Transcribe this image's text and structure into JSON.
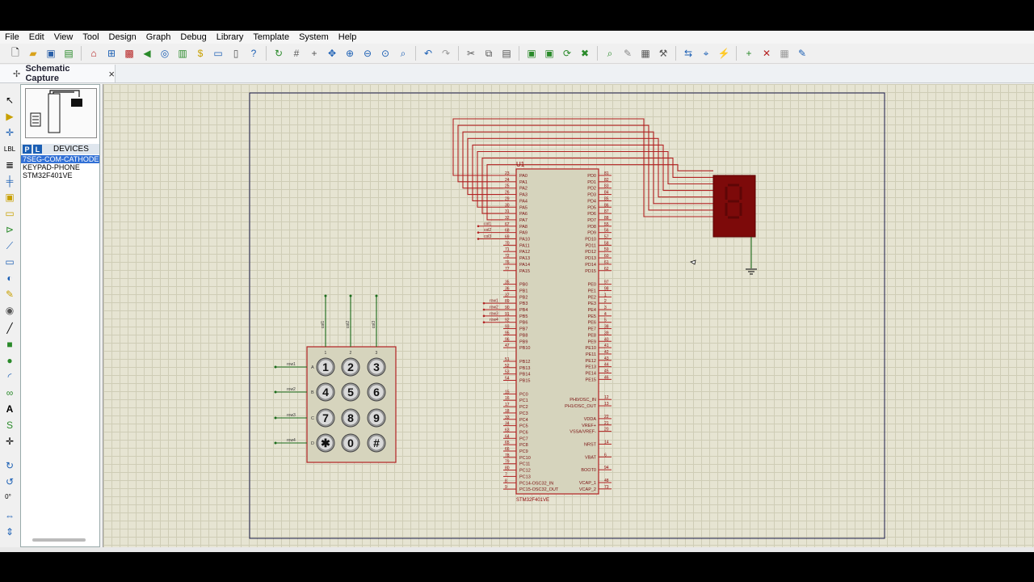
{
  "menu": [
    "File",
    "Edit",
    "View",
    "Tool",
    "Design",
    "Graph",
    "Debug",
    "Library",
    "Template",
    "System",
    "Help"
  ],
  "tab": {
    "label": "Schematic Capture",
    "close": "×"
  },
  "devices": {
    "title": "DEVICES",
    "p": "P",
    "l": "L",
    "items": [
      "7SEG-COM-CATHODE",
      "KEYPAD-PHONE",
      "STM32F401VE"
    ],
    "selected": 0
  },
  "rotation": "0°",
  "colors": {
    "wire": "#b22222",
    "part_fill": "#d6d4bd",
    "grid": "#e6e4d2",
    "segment": "#7d0a0a",
    "ground": "#1a6b1a"
  },
  "mcu": {
    "ref": "U1",
    "name": "STM32F401VE",
    "left_pins": [
      [
        "23",
        "PA0"
      ],
      [
        "24",
        "PA1"
      ],
      [
        "25",
        "PA2"
      ],
      [
        "26",
        "PA3"
      ],
      [
        "29",
        "PA4"
      ],
      [
        "30",
        "PA5"
      ],
      [
        "31",
        "PA6"
      ],
      [
        "32",
        "PA7"
      ],
      [
        "67",
        "PA8"
      ],
      [
        "68",
        "PA9"
      ],
      [
        "69",
        "PA10"
      ],
      [
        "70",
        "PA11"
      ],
      [
        "71",
        "PA12"
      ],
      [
        "72",
        "PA13"
      ],
      [
        "76",
        "PA14"
      ],
      [
        "77",
        "PA15"
      ],
      [
        "35",
        "PB0"
      ],
      [
        "36",
        "PB1"
      ],
      [
        "37",
        "PB2"
      ],
      [
        "89",
        "PB3"
      ],
      [
        "90",
        "PB4"
      ],
      [
        "91",
        "PB5"
      ],
      [
        "92",
        "PB6"
      ],
      [
        "93",
        "PB7"
      ],
      [
        "95",
        "PB8"
      ],
      [
        "96",
        "PB9"
      ],
      [
        "47",
        "PB10"
      ],
      [
        "51",
        "PB12"
      ],
      [
        "52",
        "PB13"
      ],
      [
        "53",
        "PB14"
      ],
      [
        "54",
        "PB15"
      ],
      [
        "15",
        "PC0"
      ],
      [
        "16",
        "PC1"
      ],
      [
        "17",
        "PC2"
      ],
      [
        "18",
        "PC3"
      ],
      [
        "33",
        "PC4"
      ],
      [
        "34",
        "PC5"
      ],
      [
        "63",
        "PC6"
      ],
      [
        "64",
        "PC7"
      ],
      [
        "65",
        "PC8"
      ],
      [
        "66",
        "PC9"
      ],
      [
        "78",
        "PC10"
      ],
      [
        "79",
        "PC11"
      ],
      [
        "80",
        "PC12"
      ],
      [
        "7",
        "PC13"
      ],
      [
        "8",
        "PC14-OSC32_IN"
      ],
      [
        "9",
        "PC15-OSC32_OUT"
      ]
    ],
    "right_pins": [
      [
        "81",
        "PD0"
      ],
      [
        "82",
        "PD1"
      ],
      [
        "83",
        "PD2"
      ],
      [
        "84",
        "PD3"
      ],
      [
        "85",
        "PD4"
      ],
      [
        "86",
        "PD5"
      ],
      [
        "87",
        "PD6"
      ],
      [
        "88",
        "PD7"
      ],
      [
        "55",
        "PD8"
      ],
      [
        "56",
        "PD9"
      ],
      [
        "57",
        "PD10"
      ],
      [
        "58",
        "PD11"
      ],
      [
        "59",
        "PD12"
      ],
      [
        "60",
        "PD13"
      ],
      [
        "61",
        "PD14"
      ],
      [
        "62",
        "PD15"
      ],
      [
        "97",
        "PE0"
      ],
      [
        "98",
        "PE1"
      ],
      [
        "1",
        "PE2"
      ],
      [
        "2",
        "PE3"
      ],
      [
        "3",
        "PE4"
      ],
      [
        "4",
        "PE5"
      ],
      [
        "5",
        "PE6"
      ],
      [
        "38",
        "PE7"
      ],
      [
        "39",
        "PE8"
      ],
      [
        "40",
        "PE9"
      ],
      [
        "41",
        "PE10"
      ],
      [
        "42",
        "PE11"
      ],
      [
        "43",
        "PE12"
      ],
      [
        "44",
        "PE13"
      ],
      [
        "45",
        "PE14"
      ],
      [
        "46",
        "PE15"
      ],
      [
        "12",
        "PH0/OSC_IN"
      ],
      [
        "13",
        "PH1/OSC_OUT"
      ],
      [
        "22",
        "VDDA"
      ],
      [
        "21",
        "VREF+"
      ],
      [
        "20",
        "VSSA/VREF-"
      ],
      [
        "14",
        "NRST"
      ],
      [
        "6",
        "VBAT"
      ],
      [
        "94",
        "BOOT0"
      ],
      [
        "48",
        "VCAP_1"
      ],
      [
        "73",
        "VCAP_2"
      ]
    ]
  },
  "nets": {
    "cols": [
      "col1",
      "col2",
      "col3"
    ],
    "rows": [
      "row1",
      "row2",
      "row3",
      "row4"
    ]
  },
  "keypad": {
    "keys": [
      "1",
      "2",
      "3",
      "4",
      "5",
      "6",
      "7",
      "8",
      "9",
      "✱",
      "0",
      "#"
    ],
    "row_labels": [
      "A",
      "B",
      "C",
      "D"
    ],
    "col_nums": [
      "1",
      "2",
      "3"
    ]
  }
}
